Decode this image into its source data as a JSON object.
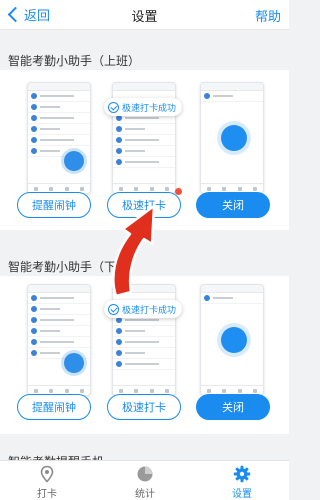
{
  "header": {
    "back_label": "返回",
    "title": "设置",
    "help_label": "帮助"
  },
  "sections": [
    {
      "title": "智能考勤小助手（上班）",
      "toast": "极速打卡成功",
      "buttons": {
        "remind": "提醒闹钟",
        "fast": "极速打卡",
        "close": "关闭"
      }
    },
    {
      "title": "智能考勤小助手（下班）",
      "toast": "极速打卡成功",
      "buttons": {
        "remind": "提醒闹钟",
        "fast": "极速打卡",
        "close": "关闭"
      }
    }
  ],
  "partial_section_title": "智能考勤提醒手机",
  "tabbar": [
    {
      "label": "打卡",
      "icon": "location-pin-icon"
    },
    {
      "label": "统计",
      "icon": "pie-chart-icon"
    },
    {
      "label": "设置",
      "icon": "gear-icon"
    }
  ],
  "colors": {
    "accent": "#1a8cf0",
    "background": "#f1f2f4",
    "arrow": "#e02f1c",
    "dot": "#f0503c"
  }
}
